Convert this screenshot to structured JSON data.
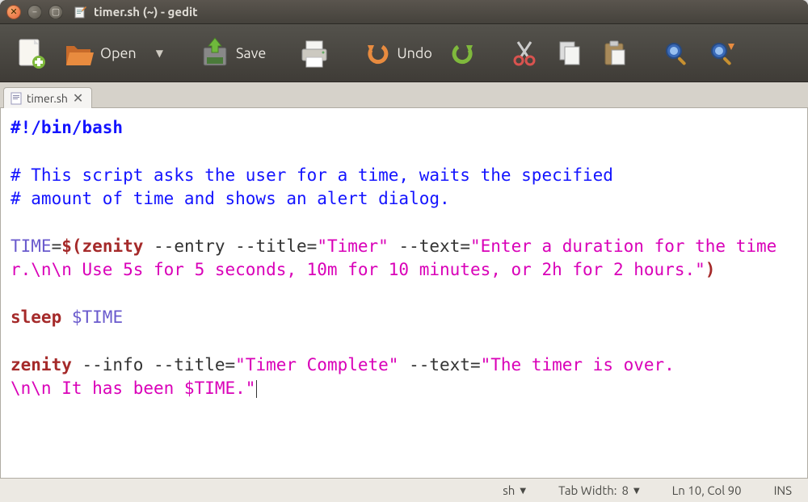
{
  "window": {
    "title": "timer.sh (~) - gedit"
  },
  "toolbar": {
    "open_label": "Open",
    "save_label": "Save",
    "undo_label": "Undo"
  },
  "tab": {
    "filename": "timer.sh"
  },
  "code": {
    "shebang": "#!/bin/bash",
    "comment1": "# This script asks the user for a time, waits the specified",
    "comment2": "# amount of time and shows an alert dialog.",
    "l4_var": "TIME",
    "l4_eq": "=",
    "l4_dol": "$(",
    "l4_cmd": "zenity",
    "l4_opts": " --entry --title=",
    "l4_s1": "\"Timer\"",
    "l4_opt2": " --text=",
    "l4_s2a": "\"Enter a duration ",
    "l4_s2b": "for the timer.\\n\\n Use 5s for 5 seconds, 10m for 10 minutes, or ",
    "l4_s2c": "2h for 2 hours.\"",
    "l4_close": ")",
    "l5_cmd": "sleep",
    "l5_sp": " ",
    "l5_var": "$TIME",
    "l6_cmd": "zenity",
    "l6_opts": " --info --title=",
    "l6_s1": "\"Timer Complete\"",
    "l6_opt2": " --text=",
    "l6_s2a": "\"The timer is over.",
    "l6_s2b": "\\n\\n It has been $TIME.\""
  },
  "status": {
    "language": "sh",
    "tab_width_label": "Tab Width:",
    "tab_width_value": "8",
    "cursor": "Ln 10, Col 90",
    "ins": "INS"
  }
}
